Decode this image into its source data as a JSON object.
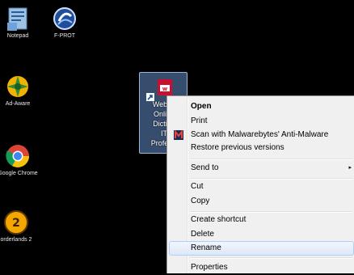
{
  "desktop": {
    "icons": [
      {
        "label": "Notepad",
        "icon": "notepad-icon"
      },
      {
        "label": "F-PROT",
        "icon": "fprot-icon"
      },
      {
        "label": "Ad-Aware",
        "icon": "adaware-icon"
      },
      {
        "label": "Google Chrome",
        "icon": "chrome-icon"
      },
      {
        "label": "orderlands 2",
        "icon": "borderlands-icon"
      }
    ],
    "selected": {
      "label": "Webop\nOnline\nDiction\nIT\nProfessi",
      "icon": "webopedia-icon"
    }
  },
  "context_menu": {
    "items": [
      {
        "label": "Open",
        "bold": true
      },
      {
        "label": "Print"
      },
      {
        "label": "Scan with Malwarebytes' Anti-Malware",
        "icon": "malwarebytes-icon"
      },
      {
        "label": "Restore previous versions"
      },
      {
        "label": "Send to",
        "submenu": true,
        "arrow": "▸"
      },
      {
        "label": "Cut"
      },
      {
        "label": "Copy"
      },
      {
        "label": "Create shortcut"
      },
      {
        "label": "Delete"
      },
      {
        "label": "Rename",
        "highlighted": true
      },
      {
        "label": "Properties"
      }
    ]
  },
  "colors": {
    "desktop_bg": "#000000",
    "menu_bg": "#f0f0f0",
    "highlight_border": "#aecff7",
    "selection": "#648cc8"
  }
}
